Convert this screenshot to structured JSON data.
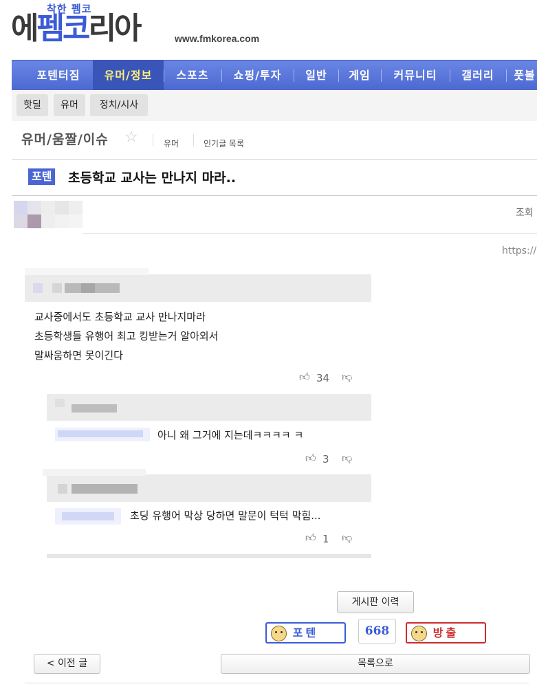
{
  "logo": {
    "tagline": "착한 펨코",
    "text_part1": "에",
    "text_part2": "펨코",
    "text_part3": "리아",
    "url": "www.fmkorea.com"
  },
  "nav": {
    "items": [
      {
        "label": "포텐터짐"
      },
      {
        "label": "유머/정보"
      },
      {
        "label": "스포츠"
      },
      {
        "label": "쇼핑/투자"
      },
      {
        "label": "일반"
      },
      {
        "label": "게임"
      },
      {
        "label": "커뮤니티"
      },
      {
        "label": "갤러리"
      },
      {
        "label": "풋볼"
      }
    ]
  },
  "subnav": {
    "items": [
      {
        "label": "핫딜"
      },
      {
        "label": "유머"
      },
      {
        "label": "정치/시사"
      }
    ]
  },
  "board": {
    "title": "유머/움짤/이슈",
    "link1": "유머",
    "link2": "인기글 목록"
  },
  "post": {
    "badge": "포텐",
    "title": "초등학교 교사는 만나지 마라..",
    "views_label": "조회",
    "url_prefix": "https://"
  },
  "comments": [
    {
      "text_lines": [
        "교사중에서도 초등학교 교사 만나지마라",
        "초등학생들 유행어 최고 킹받는거 알아외서",
        "말싸움하면 못이긴다"
      ],
      "votes": "34"
    },
    {
      "text": "아니 왜 그거에 지는데ㅋㅋㅋㅋ ㅋ",
      "votes": "3"
    },
    {
      "text": "초딩 유행어 막상 당하면 말문이 턱턱 막힘...",
      "votes": "1"
    }
  ],
  "buttons": {
    "history": "게시판 이력",
    "poten": "포텐",
    "count": "668",
    "bangchul": "방출",
    "prev": "< 이전 글",
    "list": "목록으로"
  },
  "colors": {
    "brand_blue": "#4c69d2",
    "active_nav_text": "#fff27a",
    "ban_red": "#cc2b2b"
  }
}
